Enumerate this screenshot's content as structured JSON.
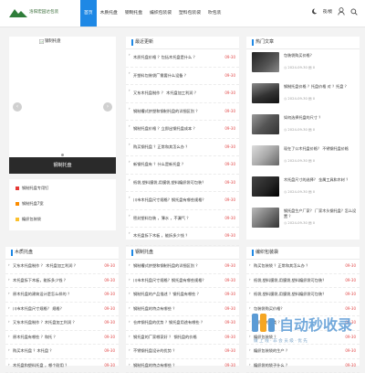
{
  "header": {
    "site_name": "洛阳宏园达包装",
    "nav": [
      "首页",
      "木质托盘",
      "钢制托盘",
      "编织包装袋",
      "塑料包装袋",
      "吹包装"
    ],
    "theme_label": "夜/模"
  },
  "slider": {
    "img_alt": "钢制托盘",
    "caption": "钢制托盘"
  },
  "latest": {
    "title": "最近更新",
    "items": [
      {
        "text": "木质托盘价格 ？包括木托盘是什么 ？",
        "date": "09-30"
      },
      {
        "text": "开塑料包装袋厂需要什么设备 ？",
        "date": "09-30"
      },
      {
        "text": "又东木托盘制作 ？ 木托盘加工利润 ？",
        "date": "09-30"
      },
      {
        "text": "钢制槽式挤塑和钢制托盘的详细区别 ？",
        "date": "09-30"
      },
      {
        "text": "钢制托盘价格 ？立即出钢托盘成本 ？",
        "date": "09-30"
      },
      {
        "text": "购买钢托盘 ？正常和其怎么办 ？",
        "date": "09-30"
      },
      {
        "text": "新钢托盘有 ？什么是新托盘 ？",
        "date": "09-30"
      },
      {
        "text": "纸袋,塑料膜袋,用膜袋,塑料编织袋可包装？",
        "date": "09-30"
      },
      {
        "text": "川市木托盘尺寸规格？钢托盘有哪些规格？",
        "date": "09-30"
      },
      {
        "text": "密封塑料包装 ，薄水 ，不漏气 ？",
        "date": "09-30"
      },
      {
        "text": "木托盘拆下木板 ，能拆多少钱 ？",
        "date": "09-30"
      }
    ]
  },
  "hot": {
    "title": "热门文章",
    "items": [
      {
        "text": "包装袋购买价格？",
        "date": "2024-09-30",
        "count": "0"
      },
      {
        "text": "钢制托盘价格 ？托盘价格 对 ？托盘 ？",
        "date": "2024-09-30",
        "count": "0"
      },
      {
        "text": "如何选择托盘的尺寸 ？",
        "date": "2024-09-30",
        "count": "0"
      },
      {
        "text": "现在了公木托盘价格？ 不锈钢托盘价格",
        "date": "2024-09-30",
        "count": "0"
      },
      {
        "text": "木托盘尺寸的选择？ 金属工具和木材 ？",
        "date": "2024-09-30",
        "count": "0"
      },
      {
        "text": "钢托盘生产厂家？ 厂家木头钢托盘？怎么设置 ？",
        "date": "2024-09-30",
        "count": "0"
      }
    ]
  },
  "side_links": [
    {
      "label": "钢制托盘专用钉"
    },
    {
      "label": "钢制托盘7宽"
    },
    {
      "label": "编织包装袋"
    }
  ],
  "wood": {
    "title": "木质托盘",
    "items": [
      {
        "text": "又东木托盘制作 ？ 木托盘加工利润 ？",
        "date": "09-30"
      },
      {
        "text": "木托盘拆下木板，能拆多少钱 ？",
        "date": "09-30"
      },
      {
        "text": "原木托盘的建筑设计是怎么样的 ？",
        "date": "09-30"
      },
      {
        "text": "川市木托盘尺寸规格？ 规格？",
        "date": "09-30"
      },
      {
        "text": "又东木托盘制作 ？木托盘加工利润 ？",
        "date": "09-30"
      },
      {
        "text": "原木托盘有哪些 ？和托 ？",
        "date": "09-30"
      },
      {
        "text": "购买木托盘 ？木托盘 ？",
        "date": "09-30"
      },
      {
        "text": "木托盘和塑料托盘 ，哪个耐用 ？",
        "date": "09-30"
      }
    ]
  },
  "steel": {
    "title": "钢制托盘",
    "items": [
      {
        "text": "钢制槽式挤塑和钢制托盘的详细区别 ？",
        "date": "09-30"
      },
      {
        "text": "川市木托盘尺寸规格？钢托盘有哪些规格？",
        "date": "09-30"
      },
      {
        "text": "钢制托盘的产品描述 ？钢托盘有哪些 ？",
        "date": "09-30"
      },
      {
        "text": "钢制托盘的特点有哪些 ？",
        "date": "09-30"
      },
      {
        "text": "仓库钢托盘的优势 ？钢托盘用途有哪些 ？",
        "date": "09-30"
      },
      {
        "text": "钢托盘的厂家哪家好 ？ 钢托盘的价格",
        "date": "09-30"
      },
      {
        "text": "不锈钢托盘设计的优势 ？",
        "date": "09-30"
      },
      {
        "text": "钢制托盘的特点有哪些 ？",
        "date": "09-30"
      }
    ]
  },
  "woven": {
    "title": "编织包装袋",
    "items": [
      {
        "text": "购买包装袋 ？正常和其怎么办 ？",
        "date": "09-30"
      },
      {
        "text": "纸袋,塑料膜袋,用膜袋,塑料编织袋可包装？",
        "date": "09-30"
      },
      {
        "text": "纸袋,塑料膜袋,用膜袋,塑料编织袋可包装？",
        "date": "09-30"
      },
      {
        "text": "包装袋购买价格？",
        "date": "09-30"
      },
      {
        "text": "编织袋的分类 ？",
        "date": "09-30"
      },
      {
        "text": "编织包装袋 ？",
        "date": "09-30"
      },
      {
        "text": "编织包装袋的生产 ？",
        "date": "09-30"
      },
      {
        "text": "编织袋的袋子什么 ？",
        "date": "09-30"
      }
    ]
  },
  "watermark": {
    "brand": "自动秒收录",
    "sub": "做 上 线 · 非 会 员 级 · 优 先"
  },
  "colors": {
    "accent": "#1e88e5",
    "date_red": "#e24b4b",
    "dark_caption": "#2a2a2a"
  }
}
